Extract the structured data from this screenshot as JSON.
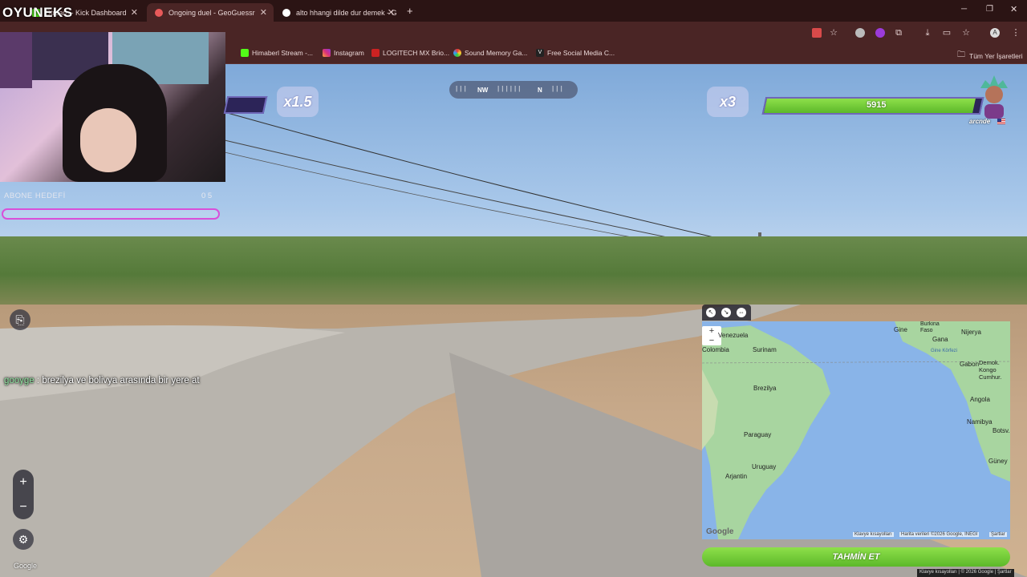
{
  "browser": {
    "tabs": [
      {
        "label": "Stream - Kick Dashboard",
        "active": false
      },
      {
        "label": "Ongoing duel - GeoGuessr",
        "active": true
      },
      {
        "label": "alto hhangi dilde dur demek - G",
        "active": false
      }
    ],
    "new_tab_label": "+",
    "bookmarks": [
      {
        "label": "Himaberl Stream -..."
      },
      {
        "label": "Instagram"
      },
      {
        "label": "LOGITECH MX Brio..."
      },
      {
        "label": "Sound Memory Ga..."
      },
      {
        "label": "Free Social Media C..."
      }
    ],
    "all_bookmarks_label": "Tüm Yer İşaretleri"
  },
  "overlay": {
    "brand": "OYUNEKS",
    "sub_goal_title": "ABONE HEDEFİ",
    "sub_goal_count": "0 5",
    "chat": {
      "user": "gooyge",
      "message": " : brezilya ve bolivya arasında bir yere at"
    }
  },
  "game": {
    "left_multiplier": "x1.5",
    "right_multiplier": "x3",
    "compass_nw": "NW",
    "compass_n": "N",
    "opponent_health": "5915",
    "opponent_health_fraction": 0.97,
    "opponent_name": "arcnde",
    "guess_button": "TAHMİN ET",
    "google_logo": "Google"
  },
  "map": {
    "labels": [
      {
        "text": "Venezuela",
        "cls": ""
      },
      {
        "text": "Colombia",
        "cls": ""
      },
      {
        "text": "Surinam",
        "cls": ""
      },
      {
        "text": "Brezilya",
        "cls": ""
      },
      {
        "text": "Paraguay",
        "cls": ""
      },
      {
        "text": "Uruguay",
        "cls": ""
      },
      {
        "text": "Arjantin",
        "cls": ""
      },
      {
        "text": "Gine",
        "cls": ""
      },
      {
        "text": "Burkina Faso",
        "cls": ""
      },
      {
        "text": "Gana",
        "cls": ""
      },
      {
        "text": "Nijerya",
        "cls": ""
      },
      {
        "text": "Gine Körfezi",
        "cls": "sea"
      },
      {
        "text": "Gabon",
        "cls": ""
      },
      {
        "text": "Demok. Kongo Cumhur.",
        "cls": ""
      },
      {
        "text": "Angola",
        "cls": ""
      },
      {
        "text": "Namibya",
        "cls": ""
      },
      {
        "text": "Botsv.",
        "cls": ""
      },
      {
        "text": "Güney",
        "cls": ""
      }
    ],
    "attribution_keys": "Klavye kısayolları",
    "attribution_data": "Harita verileri ©2026 Google, INEGI",
    "attribution_terms": "Şartlar",
    "google_logo": "Google"
  },
  "footer": {
    "keys": "Klavye kısayolları",
    "copy": "© 2026 Google",
    "terms": "Şartlar"
  }
}
